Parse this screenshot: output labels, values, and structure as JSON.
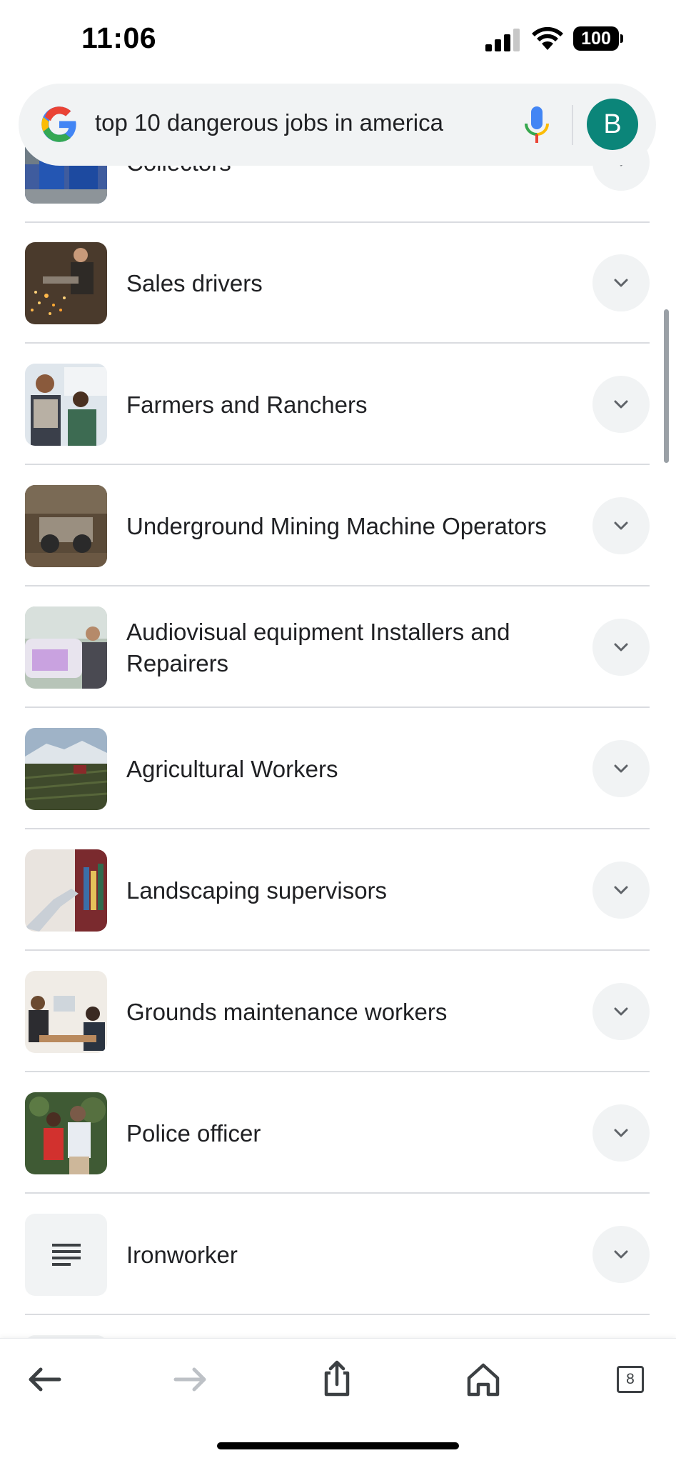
{
  "status": {
    "time": "11:06",
    "battery": "100"
  },
  "search": {
    "query": "top 10 dangerous jobs in america",
    "avatar_letter": "B"
  },
  "results": [
    {
      "label": "Collectors",
      "thumb": "refuse-collectors-photo"
    },
    {
      "label": "Sales drivers",
      "thumb": "welder-sparks-photo"
    },
    {
      "label": "Farmers and Ranchers",
      "thumb": "farmers-photo"
    },
    {
      "label": "Underground Mining Machine Operators",
      "thumb": "mining-machine-photo"
    },
    {
      "label": "Audiovisual equipment Installers and Repairers",
      "thumb": "audiovisual-photo"
    },
    {
      "label": "Agricultural Workers",
      "thumb": "tractor-field-photo"
    },
    {
      "label": "Landscaping supervisors",
      "thumb": "books-shelf-photo"
    },
    {
      "label": "Grounds maintenance workers",
      "thumb": "office-workers-photo"
    },
    {
      "label": "Police officer",
      "thumb": "couple-dancing-photo"
    },
    {
      "label": "Ironworker",
      "thumb": "document-lines-icon"
    }
  ],
  "toolbar": {
    "tabs_count": "8"
  },
  "colors": {
    "avatar": "#0b8579",
    "chip_bg": "#f1f3f4",
    "divider": "#dadce0"
  }
}
